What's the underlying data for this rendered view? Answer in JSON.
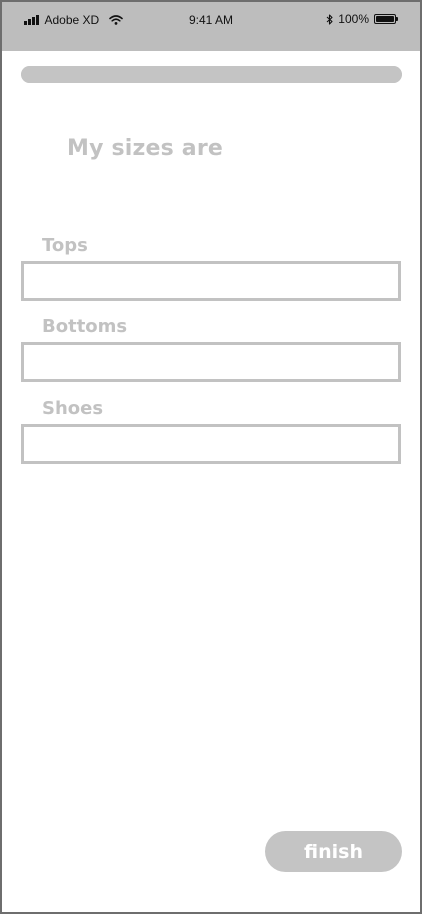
{
  "status_bar": {
    "carrier": "Adobe XD",
    "time": "9:41 AM",
    "battery": "100%",
    "icons": [
      "signal-icon",
      "wifi-icon",
      "bluetooth-icon",
      "battery-icon"
    ]
  },
  "progress": {
    "value": 1.0
  },
  "title": "My sizes are",
  "fields": {
    "tops": {
      "label": "Tops",
      "value": ""
    },
    "bottoms": {
      "label": "Bottoms",
      "value": ""
    },
    "shoes": {
      "label": "Shoes",
      "value": ""
    }
  },
  "finish_label": "finish",
  "colors": {
    "status_bar_bg": "#bdbdbd",
    "placeholder_gray": "#c2c2c2",
    "frame_border": "#6e6e6e"
  }
}
